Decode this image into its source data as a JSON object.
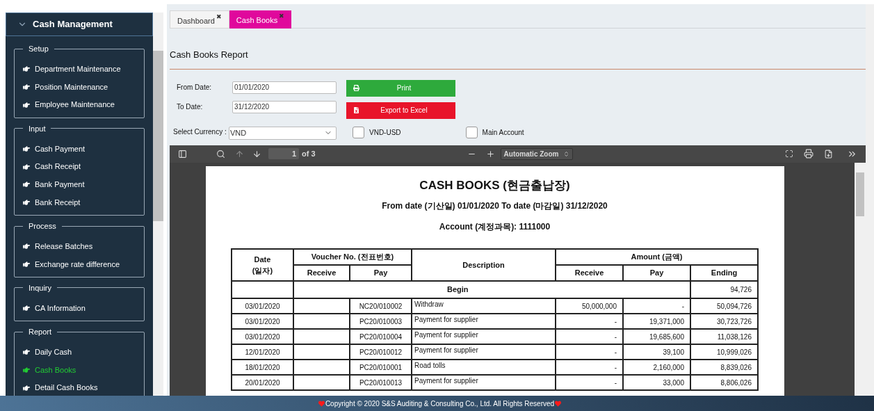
{
  "sidebar": {
    "title": "Cash Management",
    "groups": [
      {
        "label": "Setup",
        "items": [
          {
            "label": "Department Maintenance",
            "selected": false
          },
          {
            "label": "Position Maintenance",
            "selected": false
          },
          {
            "label": "Employee Maintenance",
            "selected": false
          }
        ]
      },
      {
        "label": "Input",
        "items": [
          {
            "label": "Cash Payment",
            "selected": false
          },
          {
            "label": "Cash Receipt",
            "selected": false
          },
          {
            "label": "Bank Payment",
            "selected": false
          },
          {
            "label": "Bank Receipt",
            "selected": false
          }
        ]
      },
      {
        "label": "Process",
        "items": [
          {
            "label": "Release Batches",
            "selected": false
          },
          {
            "label": "Exchange rate difference",
            "selected": false
          }
        ]
      },
      {
        "label": "Inquiry",
        "items": [
          {
            "label": "CA Information",
            "selected": false
          }
        ]
      },
      {
        "label": "Report",
        "items": [
          {
            "label": "Daily Cash",
            "selected": false
          },
          {
            "label": "Cash Books",
            "selected": true
          },
          {
            "label": "Detail Cash Books",
            "selected": false
          }
        ]
      }
    ]
  },
  "tabs": [
    {
      "label": "Dashboard",
      "selected": false,
      "close": "✖"
    },
    {
      "label": "Cash Books",
      "selected": true,
      "close": "✖"
    }
  ],
  "report": {
    "title": "Cash Books Report",
    "fields": [
      {
        "label": "From Date:",
        "value": "01/01/2020"
      },
      {
        "label": "To Date:",
        "value": "31/12/2020"
      }
    ],
    "buttons": [
      {
        "kind": "print",
        "label": "Print"
      },
      {
        "kind": "excel",
        "label": "Export to Excel"
      }
    ],
    "currency": {
      "label": "Select Currency :",
      "value": "VND"
    },
    "checkboxes": [
      {
        "label": "VND-USD",
        "checked": false
      },
      {
        "label": "Main Account",
        "checked": false
      }
    ]
  },
  "viewer": {
    "page": "1",
    "page_count": "of 3",
    "zoom": "Automatic Zoom"
  },
  "document": {
    "title": "CASH BOOKS (현금출납장)",
    "date_line": "From date (기산일) 01/01/2020 To date (마감일) 31/12/2020",
    "account_line": "Account (계정과목): 1111000",
    "headers": {
      "date": "Date\n(일자)",
      "voucher": "Voucher No. (전표번호)",
      "voucher_receive": "Receive",
      "voucher_pay": "Pay",
      "description": "Description",
      "amount": "Amount (금액)",
      "amount_receive": "Receive",
      "amount_pay": "Pay",
      "amount_ending": "Ending"
    },
    "begin": {
      "label": "Begin",
      "ending": "94,726"
    },
    "rows": [
      {
        "date": "03/01/2020",
        "receive": "",
        "pay": "NC20/010002",
        "description": "Withdraw",
        "amount_receive": "50,000,000",
        "amount_pay": "-",
        "ending": "50,094,726"
      },
      {
        "date": "03/01/2020",
        "receive": "",
        "pay": "PC20/010003",
        "description": "Payment for supplier",
        "amount_receive": "-",
        "amount_pay": "19,371,000",
        "ending": "30,723,726"
      },
      {
        "date": "03/01/2020",
        "receive": "",
        "pay": "PC20/010004",
        "description": "Payment for supplier",
        "amount_receive": "-",
        "amount_pay": "19,685,600",
        "ending": "11,038,126"
      },
      {
        "date": "12/01/2020",
        "receive": "",
        "pay": "PC20/010012",
        "description": "Payment for supplier",
        "amount_receive": "-",
        "amount_pay": "39,100",
        "ending": "10,999,026"
      },
      {
        "date": "18/01/2020",
        "receive": "",
        "pay": "PC20/010001",
        "description": "Road tolls",
        "amount_receive": "-",
        "amount_pay": "2,160,000",
        "ending": "8,839,026"
      },
      {
        "date": "20/01/2020",
        "receive": "",
        "pay": "PC20/010013",
        "description": "Payment for supplier",
        "amount_receive": "-",
        "amount_pay": "33,000",
        "ending": "8,806,026"
      }
    ]
  },
  "footer": {
    "text": "Copyright © 2020 S&S Auditing & Consulting Co., Ltd. All Rights Reserved"
  }
}
